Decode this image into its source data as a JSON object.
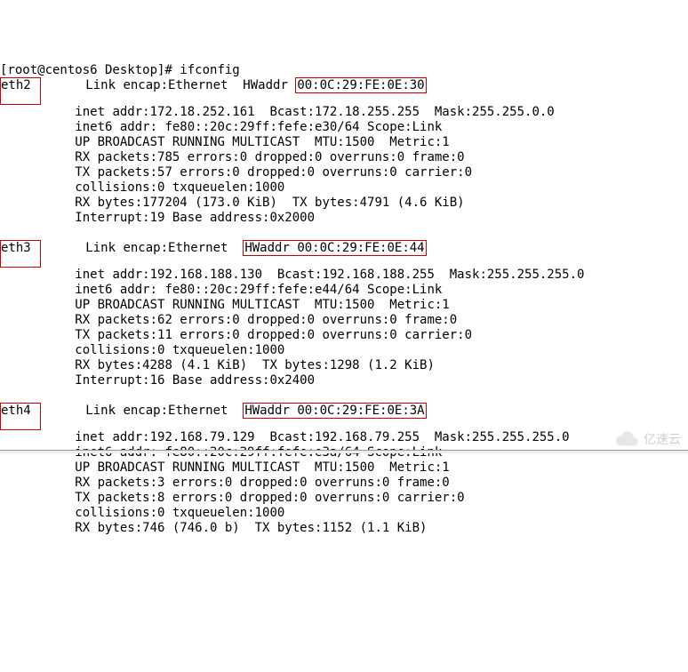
{
  "prompt": "[root@centos6 Desktop]# ",
  "command": "ifconfig",
  "watermark": "亿速云",
  "interfaces": [
    {
      "name": "eth2",
      "encap_prefix": "Link encap:Ethernet  HWaddr ",
      "hwaddr": "00:0C:29:FE:0E:30",
      "hwaddr_boxed": true,
      "hwaddr_prefix_boxed": false,
      "lines": [
        "inet addr:172.18.252.161  Bcast:172.18.255.255  Mask:255.255.0.0",
        "inet6 addr: fe80::20c:29ff:fefe:e30/64 Scope:Link",
        "UP BROADCAST RUNNING MULTICAST  MTU:1500  Metric:1",
        "RX packets:785 errors:0 dropped:0 overruns:0 frame:0",
        "TX packets:57 errors:0 dropped:0 overruns:0 carrier:0",
        "collisions:0 txqueuelen:1000",
        "RX bytes:177204 (173.0 KiB)  TX bytes:4791 (4.6 KiB)",
        "Interrupt:19 Base address:0x2000"
      ]
    },
    {
      "name": "eth3",
      "encap_prefix": "Link encap:Ethernet  ",
      "hwaddr": "HWaddr 00:0C:29:FE:0E:44",
      "hwaddr_boxed": true,
      "hwaddr_prefix_boxed": true,
      "lines": [
        "inet addr:192.168.188.130  Bcast:192.168.188.255  Mask:255.255.255.0",
        "inet6 addr: fe80::20c:29ff:fefe:e44/64 Scope:Link",
        "UP BROADCAST RUNNING MULTICAST  MTU:1500  Metric:1",
        "RX packets:62 errors:0 dropped:0 overruns:0 frame:0",
        "TX packets:11 errors:0 dropped:0 overruns:0 carrier:0",
        "collisions:0 txqueuelen:1000",
        "RX bytes:4288 (4.1 KiB)  TX bytes:1298 (1.2 KiB)",
        "Interrupt:16 Base address:0x2400"
      ]
    },
    {
      "name": "eth4",
      "encap_prefix": "Link encap:Ethernet  ",
      "hwaddr": "HWaddr 00:0C:29:FE:0E:3A",
      "hwaddr_boxed": true,
      "hwaddr_prefix_boxed": true,
      "lines": [
        "inet addr:192.168.79.129  Bcast:192.168.79.255  Mask:255.255.255.0",
        "inet6 addr: fe80::20c:29ff:fefe:e3a/64 Scope:Link",
        "UP BROADCAST RUNNING MULTICAST  MTU:1500  Metric:1",
        "RX packets:3 errors:0 dropped:0 overruns:0 frame:0",
        "TX packets:8 errors:0 dropped:0 overruns:0 carrier:0",
        "collisions:0 txqueuelen:1000",
        "RX bytes:746 (746.0 b)  TX bytes:1152 (1.1 KiB)"
      ]
    }
  ]
}
